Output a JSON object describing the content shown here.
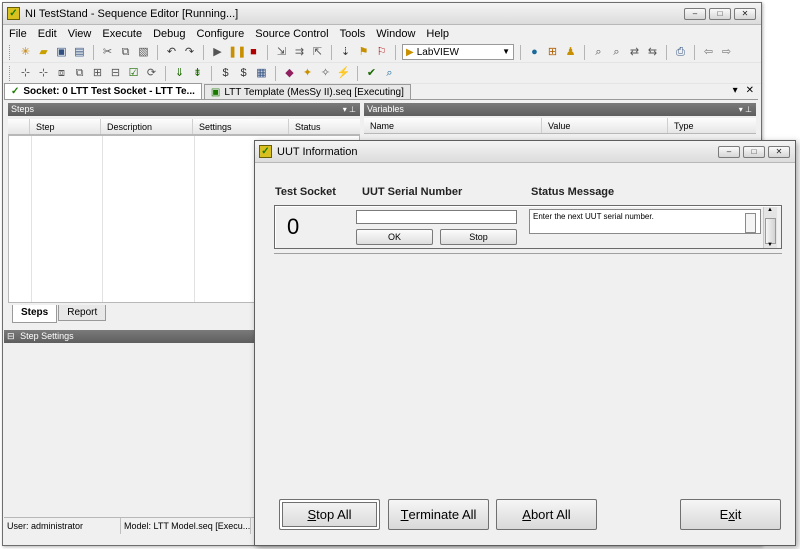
{
  "main_window": {
    "title": "NI TestStand - Sequence Editor [Running...]",
    "controls": {
      "minimize": "–",
      "maximize": "□",
      "close": "✕"
    }
  },
  "menu": [
    "File",
    "Edit",
    "View",
    "Execute",
    "Debug",
    "Configure",
    "Source Control",
    "Tools",
    "Window",
    "Help"
  ],
  "toolbar": {
    "adapter_value": "LabVIEW"
  },
  "doc_tabs": [
    {
      "label": "Socket: 0  LTT Test Socket - LTT Te...",
      "active": true
    },
    {
      "label": "LTT Template (MesSy II).seq [Executing]",
      "active": false
    }
  ],
  "doc_tab_controls": {
    "pin": "▾",
    "close": "✕"
  },
  "steps_panel": {
    "title": "Steps",
    "columns": [
      "Step",
      "Description",
      "Settings",
      "Status"
    ]
  },
  "variables_panel": {
    "title": "Variables",
    "columns": [
      "Name",
      "Value",
      "Type"
    ]
  },
  "bottom_tabs": [
    "Steps",
    "Report"
  ],
  "step_settings_panel": {
    "title": "Step Settings"
  },
  "statusbar": {
    "user": "User: administrator",
    "model": "Model: LTT Model.seq [Execu..."
  },
  "dialog": {
    "title": "UUT Information",
    "headers": {
      "socket": "Test Socket",
      "serial": "UUT Serial Number",
      "status": "Status Message"
    },
    "socket_number": "0",
    "serial_value": "",
    "ok_label": "OK",
    "stop_label": "Stop",
    "status_message": "Enter the next UUT serial number.",
    "buttons": {
      "stop_all": {
        "accel": "S",
        "rest": "top All"
      },
      "terminate_all": {
        "accel": "T",
        "rest": "erminate All"
      },
      "abort_all": {
        "accel": "A",
        "rest": "bort All"
      },
      "exit": {
        "accel": "x",
        "pre": "E",
        "rest": "it"
      }
    }
  },
  "colors": {
    "panel_header": "#6b6b6b",
    "window_bg": "#f0f0f0",
    "accent_logo": "#d8c020"
  }
}
